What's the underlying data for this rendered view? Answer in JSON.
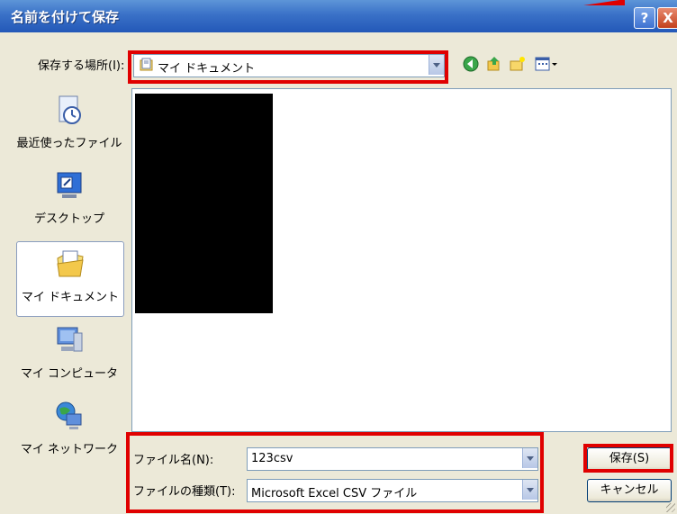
{
  "window": {
    "title": "名前を付けて保存",
    "help": "?",
    "close": "X"
  },
  "toolbar": {
    "save_in_label": "保存する場所(I):",
    "location": "マイ ドキュメント"
  },
  "places": [
    {
      "label": "最近使ったファイル",
      "icon": "recent-icon"
    },
    {
      "label": "デスクトップ",
      "icon": "desktop-icon"
    },
    {
      "label": "マイ ドキュメント",
      "icon": "my-documents-icon"
    },
    {
      "label": "マイ コンピュータ",
      "icon": "my-computer-icon"
    },
    {
      "label": "マイ ネットワーク",
      "icon": "network-icon"
    }
  ],
  "form": {
    "file_name_label": "ファイル名(N):",
    "file_name_value": "123csv",
    "file_type_label": "ファイルの種類(T):",
    "file_type_value": "Microsoft Excel CSV ファイル"
  },
  "buttons": {
    "save": "保存(S)",
    "cancel": "キャンセル"
  },
  "colors": {
    "highlight": "#e00000",
    "titlebar": "#2358b8"
  }
}
